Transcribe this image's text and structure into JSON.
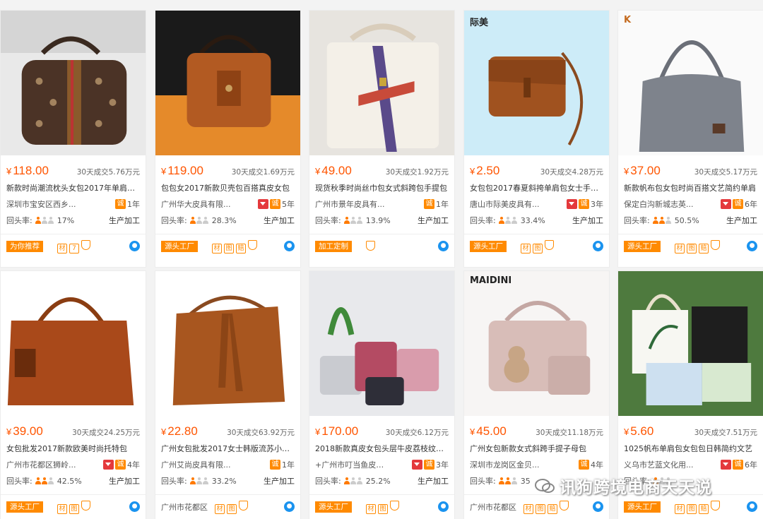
{
  "products": [
    {
      "brand": "",
      "price": "118.00",
      "sales": "30天成交5.76万元",
      "title": "新款时尚潮流枕头女包2017年单肩斜挎包",
      "location": "深圳市宝安区西乡...",
      "years": "1年",
      "repurchase_label": "回头率:",
      "repurchase": "17%",
      "persons_on": 1,
      "biz": "生产加工",
      "footer_tag": "为你推荐",
      "footer_text": "",
      "icons": [
        "材",
        "7"
      ]
    },
    {
      "brand": "",
      "price": "119.00",
      "sales": "30天成交1.69万元",
      "title": "包包女2017新款贝壳包百搭真皮女包",
      "location": "广州华大皮具有限...",
      "years": "5年",
      "repurchase_label": "回头率:",
      "repurchase": "28.3%",
      "persons_on": 1,
      "biz": "生产加工",
      "footer_tag": "源头工厂",
      "footer_text": "",
      "icons": [
        "材",
        "图",
        "赔"
      ]
    },
    {
      "brand": "",
      "price": "49.00",
      "sales": "30天成交1.92万元",
      "title": "现货秋季时尚丝巾包女式斜跨包手提包",
      "location": "广州市景年皮具有...",
      "years": "1年",
      "repurchase_label": "回头率:",
      "repurchase": "13.9%",
      "persons_on": 1,
      "biz": "生产加工",
      "footer_tag": "加工定制",
      "footer_text": "",
      "icons": []
    },
    {
      "brand": "际美",
      "price": "2.50",
      "sales": "30天成交4.28万元",
      "title": "女包包2017春夏斜挎单肩包女士手提包",
      "location": "唐山市际美皮具有...",
      "years": "3年",
      "repurchase_label": "回头率:",
      "repurchase": "33.4%",
      "persons_on": 1,
      "biz": "生产加工",
      "footer_tag": "源头工厂",
      "footer_text": "",
      "icons": [
        "材",
        "图"
      ]
    },
    {
      "brand": "K",
      "price": "37.00",
      "sales": "30天成交5.17万元",
      "title": "新款帆布包女包时尚百搭文艺简约单肩",
      "location": "保定白沟新城志英...",
      "years": "6年",
      "repurchase_label": "回头率:",
      "repurchase": "50.5%",
      "persons_on": 2,
      "biz": "生产加工",
      "footer_tag": "源头工厂",
      "footer_text": "",
      "icons": [
        "材",
        "图",
        "赔"
      ]
    },
    {
      "brand": "",
      "price": "39.00",
      "sales": "30天成交24.25万元",
      "title": "女包批发2017新款欧美时尚托特包",
      "location": "广州市花都区狮岭...",
      "years": "4年",
      "repurchase_label": "回头率:",
      "repurchase": "42.5%",
      "persons_on": 2,
      "biz": "生产加工",
      "footer_tag": "源头工厂",
      "footer_text": "",
      "icons": [
        "材",
        "图"
      ]
    },
    {
      "brand": "",
      "price": "22.80",
      "sales": "30天成交63.92万元",
      "title": "广州女包批发2017女士韩版流苏小水桶包",
      "location": "广州艾尚皮具有限...",
      "years": "1年",
      "repurchase_label": "回头率:",
      "repurchase": "33.2%",
      "persons_on": 1,
      "biz": "生产加工",
      "footer_tag": "",
      "footer_text": "广州市花都区",
      "icons": [
        "材",
        "图"
      ]
    },
    {
      "brand": "",
      "price": "170.00",
      "sales": "30天成交6.12万元",
      "title": "2018新款真皮女包头层牛皮荔枝纹手提包",
      "location": "+广州市叮当鱼皮具...",
      "years": "3年",
      "repurchase_label": "回头率:",
      "repurchase": "25.2%",
      "persons_on": 1,
      "biz": "生产加工",
      "footer_tag": "源头工厂",
      "footer_text": "",
      "icons": [
        "材",
        "图"
      ]
    },
    {
      "brand": "MAIDINI",
      "price": "45.00",
      "sales": "30天成交11.18万元",
      "title": "广州女包新款女式斜跨手提子母包",
      "location": "深圳市龙岗区金贝...",
      "years": "4年",
      "repurchase_label": "回头率:",
      "repurchase": "35",
      "persons_on": 2,
      "biz": "",
      "footer_tag": "",
      "footer_text": "广州市花都区",
      "icons": [
        "材",
        "图",
        "赔"
      ]
    },
    {
      "brand": "",
      "price": "5.60",
      "sales": "30天成交7.51万元",
      "title": "1025帆布单肩包女包包日韩简约文艺",
      "location": "义乌市艺蓝文化用...",
      "years": "6年",
      "repurchase_label": "回头率:",
      "repurchase": "",
      "persons_on": 1,
      "biz": "",
      "footer_tag": "源头工厂",
      "footer_text": "",
      "icons": [
        "材",
        "图",
        "赔"
      ]
    }
  ],
  "watermark": "讯狗跨境电商天天说",
  "colors": {
    "price": "#ff5500",
    "accent": "#ff8a00",
    "red": "#e4393c",
    "ww": "#1a93ef"
  }
}
